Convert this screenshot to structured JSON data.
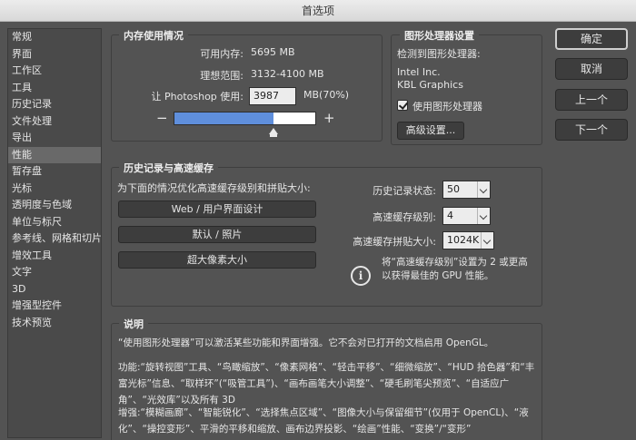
{
  "window": {
    "title": "首选项"
  },
  "sidebar": {
    "items": [
      {
        "label": "常规"
      },
      {
        "label": "界面"
      },
      {
        "label": "工作区"
      },
      {
        "label": "工具"
      },
      {
        "label": "历史记录"
      },
      {
        "label": "文件处理"
      },
      {
        "label": "导出"
      },
      {
        "label": "性能"
      },
      {
        "label": "暂存盘"
      },
      {
        "label": "光标"
      },
      {
        "label": "透明度与色域"
      },
      {
        "label": "单位与标尺"
      },
      {
        "label": "参考线、网格和切片"
      },
      {
        "label": "增效工具"
      },
      {
        "label": "文字"
      },
      {
        "label": "3D"
      },
      {
        "label": "增强型控件"
      },
      {
        "label": "技术预览"
      }
    ],
    "selected_index": 7
  },
  "memory": {
    "title": "内存使用情况",
    "available_label": "可用内存:",
    "available_value": "5695 MB",
    "ideal_label": "理想范围:",
    "ideal_value": "3132-4100 MB",
    "let_label": "让 Photoshop 使用:",
    "use_value": "3987",
    "use_unit": "MB(70%)",
    "minus": "−",
    "plus": "+",
    "slider_percent": 70
  },
  "gpu": {
    "title": "图形处理器设置",
    "detected_label": "检测到图形处理器:",
    "vendor": "Intel Inc.",
    "model": "KBL Graphics",
    "use_gpu_label": "使用图形处理器",
    "use_gpu_checked": true,
    "advanced_button": "高级设置..."
  },
  "buttons": {
    "ok": "确定",
    "cancel": "取消",
    "prev": "上一个",
    "next": "下一个"
  },
  "history": {
    "title": "历史记录与高速缓存",
    "optimize_label": "为下面的情况优化高速缓存级别和拼贴大小:",
    "opt_web": "Web / 用户界面设计",
    "opt_default": "默认 / 照片",
    "opt_huge": "超大像素大小",
    "states_label": "历史记录状态:",
    "states_value": "50",
    "levels_label": "高速缓存级别:",
    "levels_value": "4",
    "tile_label": "高速缓存拼贴大小:",
    "tile_value": "1024K",
    "info_text_1": "将“高速缓存级别”设置为 2 或更高",
    "info_text_2": "以获得最佳的 GPU 性能。"
  },
  "description": {
    "title": "说明",
    "p1": "“使用图形处理器”可以激活某些功能和界面增强。它不会对已打开的文档启用 OpenGL。",
    "p2_l1": "功能:“旋转视图”工具、“鸟瞰缩放”、“像素网格”、“轻击平移”、“细微缩放”、“HUD 拾色器”和“丰",
    "p2_l2": "富光标”信息、“取样环”(“吸管工具”)、“画布画笔大小调整”、“硬毛刷笔尖预览”、“自适应广",
    "p2_l3": "角”、“光效库”以及所有 3D",
    "p3_l1": "增强:“模糊画廊”、“智能锐化”、“选择焦点区域”、“图像大小与保留细节”(仅用于 OpenCL)、“液",
    "p3_l2": "化”、“操控变形”、平滑的平移和缩放、画布边界投影、“绘画”性能、“变换”/“变形”"
  },
  "colors": {
    "accent": "#5f8fdc",
    "panel": "#535353",
    "sidebar_selected": "#696969"
  }
}
